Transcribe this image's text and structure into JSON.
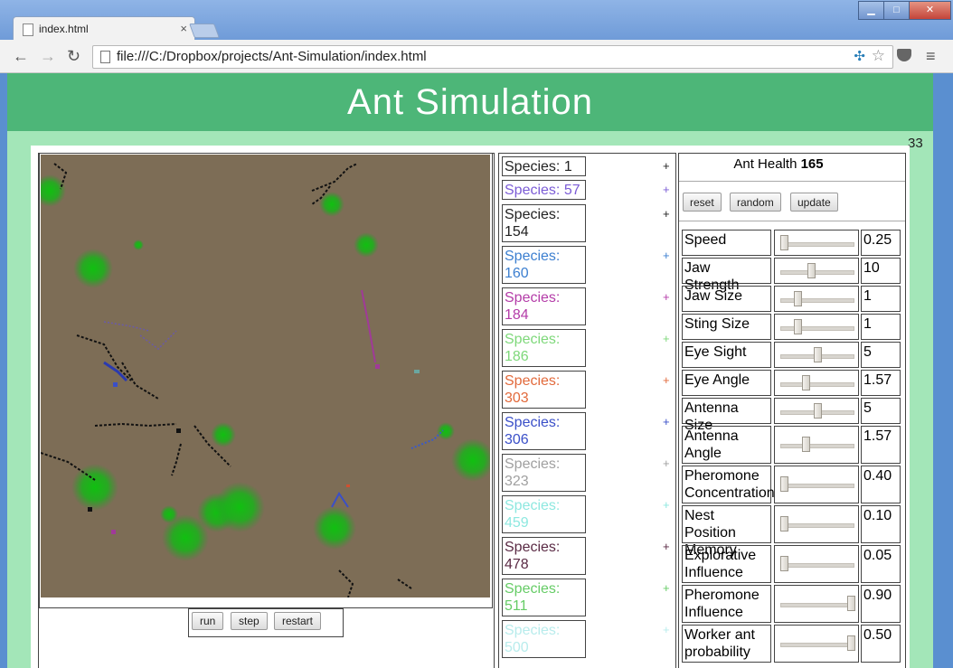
{
  "browser": {
    "tab_title": "index.html",
    "url": "file:///C:/Dropbox/projects/Ant-Simulation/index.html"
  },
  "page": {
    "title": "Ant Simulation",
    "counter": "33"
  },
  "controls": {
    "run": "run",
    "step": "step",
    "restart": "restart"
  },
  "species": [
    {
      "label": "Species: 1",
      "plus": "+",
      "color": "#222222"
    },
    {
      "label": "Species: 57",
      "plus": "+",
      "color": "#7b5cd6"
    },
    {
      "label": "Species: 154",
      "plus": "+",
      "color": "#222222"
    },
    {
      "label": "Species: 160",
      "plus": "+",
      "color": "#3c7fd0"
    },
    {
      "label": "Species: 184",
      "plus": "+",
      "color": "#b43ca8"
    },
    {
      "label": "Species: 186",
      "plus": "+",
      "color": "#7ed87a"
    },
    {
      "label": "Species: 303",
      "plus": "+",
      "color": "#e26a3c"
    },
    {
      "label": "Species: 306",
      "plus": "+",
      "color": "#3a4fc8"
    },
    {
      "label": "Species: 323",
      "plus": "+",
      "color": "#a0a0a0"
    },
    {
      "label": "Species: 459",
      "plus": "+",
      "color": "#8ee8e0"
    },
    {
      "label": "Species: 478",
      "plus": "+",
      "color": "#5a2a44"
    },
    {
      "label": "Species: 511",
      "plus": "+",
      "color": "#66cc66"
    },
    {
      "label": "Species: 500",
      "plus": "+",
      "color": "#b8ecec"
    }
  ],
  "settings": {
    "health_label": "Ant Health",
    "health_value": "165",
    "reset": "reset",
    "random": "random",
    "update": "update",
    "params": [
      {
        "name": "Speed",
        "value": "0.25",
        "level": 0.0
      },
      {
        "name": "Jaw Strength",
        "value": "10",
        "level": 0.4
      },
      {
        "name": "Jaw Size",
        "value": "1",
        "level": 0.2
      },
      {
        "name": "Sting Size",
        "value": "1",
        "level": 0.2
      },
      {
        "name": "Eye Sight",
        "value": "5",
        "level": 0.5
      },
      {
        "name": "Eye Angle",
        "value": "1.57",
        "level": 0.33
      },
      {
        "name": "Antenna Size",
        "value": "5",
        "level": 0.5
      },
      {
        "name": "Antenna Angle",
        "value": "1.57",
        "level": 0.33
      },
      {
        "name": "Pheromone Concentration",
        "value": "0.40",
        "level": 0.0
      },
      {
        "name": "Nest Position Memory",
        "value": "0.10",
        "level": 0.0
      },
      {
        "name": "Explorative Influence",
        "value": "0.05",
        "level": 0.0
      },
      {
        "name": "Pheromone Influence",
        "value": "0.90",
        "level": 1.0
      },
      {
        "name": "Worker ant probability",
        "value": "0.50",
        "level": 1.0
      }
    ]
  }
}
